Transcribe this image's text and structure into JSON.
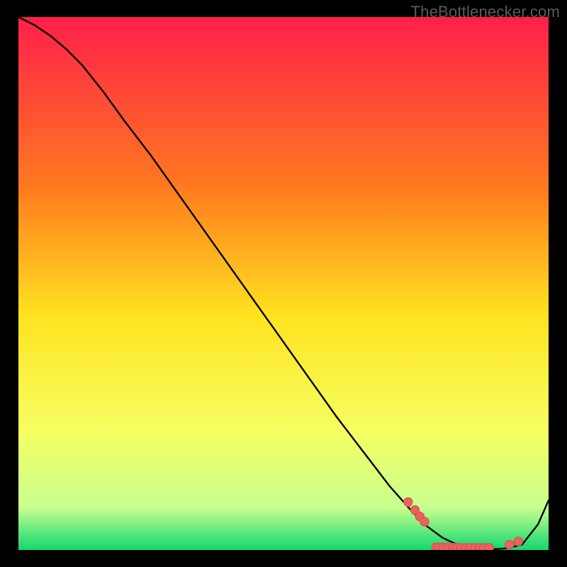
{
  "watermark": "TheBottlenecker.com",
  "colors": {
    "top": "#ff1f4a",
    "mid_upper": "#ff7a1f",
    "mid": "#ffe31f",
    "mid_lower": "#f5ff63",
    "near_bottom": "#c8ff8f",
    "bottom": "#12d86f",
    "line": "#000000",
    "marker_fill": "#e9635f",
    "marker_stroke": "#d94c49"
  },
  "chart_data": {
    "type": "line",
    "title": "",
    "xlabel": "",
    "ylabel": "",
    "xlim": [
      0,
      100
    ],
    "ylim": [
      0,
      100
    ],
    "series": [
      {
        "name": "curve",
        "x": [
          0,
          3,
          6,
          9,
          12,
          16,
          20,
          25,
          30,
          35,
          40,
          45,
          50,
          55,
          60,
          65,
          70,
          74,
          77,
          80,
          83,
          86,
          89,
          92,
          95,
          98,
          100
        ],
        "y": [
          100,
          98.5,
          96.5,
          94,
          91,
          86,
          80.5,
          74,
          67,
          60,
          53,
          46,
          39,
          32,
          25,
          18.5,
          12,
          7.5,
          4.5,
          2.3,
          0.9,
          0.25,
          0.1,
          0.3,
          1.0,
          4.8,
          9.3
        ]
      }
    ],
    "markers": {
      "name": "dots",
      "x": [
        73.5,
        74.8,
        75.7,
        76.6,
        78.8,
        79.3,
        80.1,
        81.0,
        82.0,
        82.7,
        83.5,
        84.4,
        85.2,
        86.1,
        87.0,
        87.8,
        88.8,
        92.6,
        94.3
      ],
      "y": [
        9.0,
        7.5,
        6.3,
        5.3,
        0.5,
        0.5,
        0.5,
        0.5,
        0.45,
        0.45,
        0.4,
        0.4,
        0.4,
        0.4,
        0.4,
        0.4,
        0.4,
        1.0,
        1.6
      ]
    }
  }
}
